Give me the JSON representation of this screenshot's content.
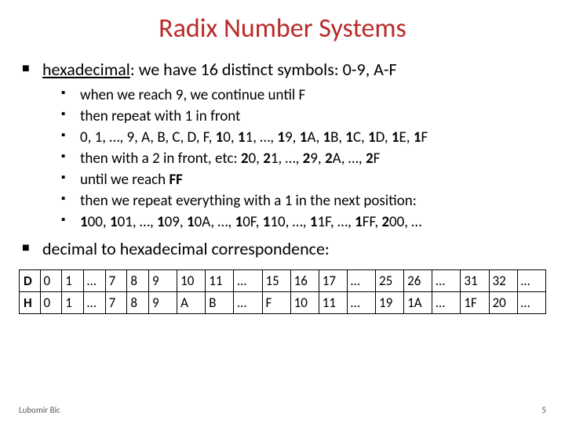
{
  "title": "Radix Number Systems",
  "bullets": {
    "hex_label": "hexadecimal",
    "hex_rest": ": we have 16 distinct symbols: 0-9, A-F",
    "hex_sub": [
      {
        "type": "plain",
        "text": "when we reach 9, we continue until F"
      },
      {
        "type": "plain",
        "text": "then repeat with 1 in front"
      },
      {
        "type": "seq1",
        "prefix": "0, 1, …, 9, A, B, C, D, F,  ",
        "a": "1",
        "mid1": "0, ",
        "b": "1",
        "mid2": "1, …, ",
        "c": "1",
        "mid3": "9, ",
        "d": "1",
        "mid4": "A, ",
        "e": "1",
        "mid5": "B, ",
        "f": "1",
        "mid6": "C, ",
        "g": "1",
        "mid7": "D, ",
        "h": "1",
        "mid8": "E, ",
        "i": "1",
        "tail": "F"
      },
      {
        "type": "seq2",
        "prefix": "then with a 2 in front, etc: ",
        "a": "2",
        "mid1": "0, ",
        "b": "2",
        "mid2": "1, …, ",
        "c": "2",
        "mid3": "9, ",
        "d": "2",
        "mid4": "A, …, ",
        "e": "2",
        "tail": "F"
      },
      {
        "type": "ff",
        "prefix": "until we reach ",
        "bold": "FF"
      },
      {
        "type": "plain",
        "text": "then we repeat everything with a 1 in the next position:"
      },
      {
        "type": "bold1",
        "a": "1",
        "r1": "00, ",
        "b": "1",
        "r2": "01, …, ",
        "c": "1",
        "r3": "09, ",
        "d": "1",
        "r4": "0A, …, ",
        "e": "1",
        "r5": "0F, ",
        "f": "1",
        "r6": "10, …, ",
        "g": "1",
        "r7": "1F, …, ",
        "h": "1",
        "r8": "FF, ",
        "i": "2",
        "r9": "00, …"
      }
    ],
    "dec_to_hex": "decimal to hexadecimal correspondence:"
  },
  "table": {
    "row_d_label": "D",
    "row_h_label": "H",
    "d": [
      "0",
      "1",
      "…",
      "7",
      "8",
      "9",
      "10",
      "11",
      "…",
      "15",
      "16",
      "17",
      "…",
      "25",
      "26",
      "…",
      "31",
      "32",
      "…"
    ],
    "h": [
      "0",
      "1",
      "…",
      "7",
      "8",
      "9",
      "A",
      "B",
      "…",
      "F",
      "10",
      "11",
      "…",
      "19",
      "1A",
      "…",
      "1F",
      "20",
      "…"
    ]
  },
  "footer": {
    "author": "Lubomir Bic",
    "page": "5"
  }
}
